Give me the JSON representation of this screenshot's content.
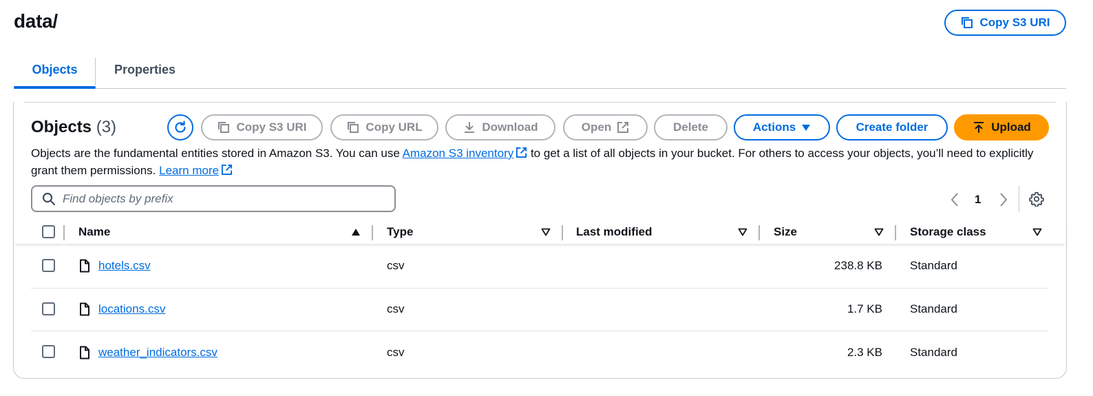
{
  "page": {
    "title": "data/",
    "copy_s3_uri_label": "Copy S3 URI"
  },
  "tabs": [
    {
      "label": "Objects",
      "active": true
    },
    {
      "label": "Properties",
      "active": false
    }
  ],
  "objects_panel": {
    "title": "Objects",
    "count": "(3)",
    "toolbar": {
      "copy_s3_uri": "Copy S3 URI",
      "copy_url": "Copy URL",
      "download": "Download",
      "open": "Open",
      "delete": "Delete",
      "actions": "Actions",
      "create_folder": "Create folder",
      "upload": "Upload"
    },
    "description": {
      "part1": "Objects are the fundamental entities stored in Amazon S3. You can use ",
      "link1": "Amazon S3 inventory",
      "part2": " to get a list of all objects in your bucket. For others to access your objects, you’ll need to explicitly grant them permissions. ",
      "link2": "Learn more"
    },
    "search": {
      "placeholder": "Find objects by prefix",
      "value": ""
    },
    "pagination": {
      "current_page": "1"
    }
  },
  "table": {
    "columns": [
      "Name",
      "Type",
      "Last modified",
      "Size",
      "Storage class"
    ],
    "rows": [
      {
        "name": "hotels.csv",
        "type": "csv",
        "last_modified": "",
        "size": "238.8 KB",
        "storage_class": "Standard"
      },
      {
        "name": "locations.csv",
        "type": "csv",
        "last_modified": "",
        "size": "1.7 KB",
        "storage_class": "Standard"
      },
      {
        "name": "weather_indicators.csv",
        "type": "csv",
        "last_modified": "",
        "size": "2.3 KB",
        "storage_class": "Standard"
      }
    ]
  },
  "colors": {
    "accent": "#006ce0",
    "upload": "#ff9900",
    "disabled": "#8c8c94",
    "text": "#0f141a"
  }
}
